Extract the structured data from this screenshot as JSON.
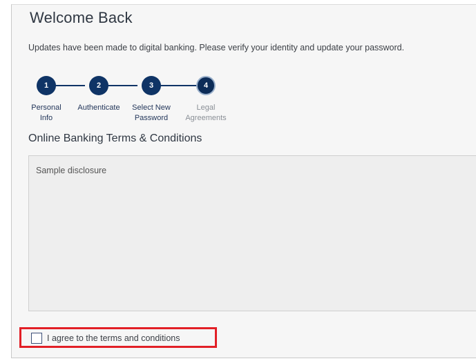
{
  "header": {
    "title": "Welcome Back",
    "subtitle": "Updates have been made to digital banking. Please verify your identity and update your password."
  },
  "stepper": {
    "current_step": 4,
    "steps": [
      {
        "number": "1",
        "label_line1": "Personal",
        "label_line2": "Info"
      },
      {
        "number": "2",
        "label_line1": "Authenticate",
        "label_line2": ""
      },
      {
        "number": "3",
        "label_line1": "Select New",
        "label_line2": "Password"
      },
      {
        "number": "4",
        "label_line1": "Legal",
        "label_line2": "Agreements"
      }
    ]
  },
  "terms": {
    "section_title": "Online Banking Terms & Conditions",
    "disclosure_text": "Sample disclosure",
    "agree_label": "I agree to the terms and conditions",
    "agree_checked": false
  },
  "colors": {
    "step_accent": "#0f3466",
    "highlight": "#e21f26"
  }
}
